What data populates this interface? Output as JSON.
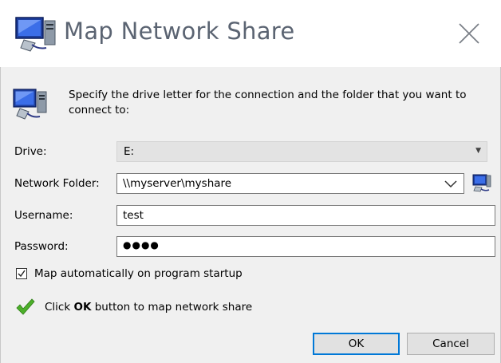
{
  "window": {
    "title": "Map Network Share",
    "icon": "network-drive-icon",
    "close_icon": "close-icon"
  },
  "instructions": "Specify the drive letter for the connection and the folder that you want to connect to:",
  "form": {
    "drive": {
      "label": "Drive:",
      "value": "E:"
    },
    "network_folder": {
      "label": "Network Folder:",
      "value": "\\\\myserver\\myshare"
    },
    "username": {
      "label": "Username:",
      "value": "test"
    },
    "password": {
      "label": "Password:",
      "value": "●●●●"
    }
  },
  "map_automatically": {
    "label": "Map automatically on program startup",
    "checked": true
  },
  "hint": {
    "prefix": "Click ",
    "bold": "OK",
    "suffix": " button to map network share"
  },
  "buttons": {
    "ok": "OK",
    "cancel": "Cancel"
  },
  "colors": {
    "accent": "#0078d7",
    "success": "#4caf2a",
    "title_text": "#5b6472"
  }
}
